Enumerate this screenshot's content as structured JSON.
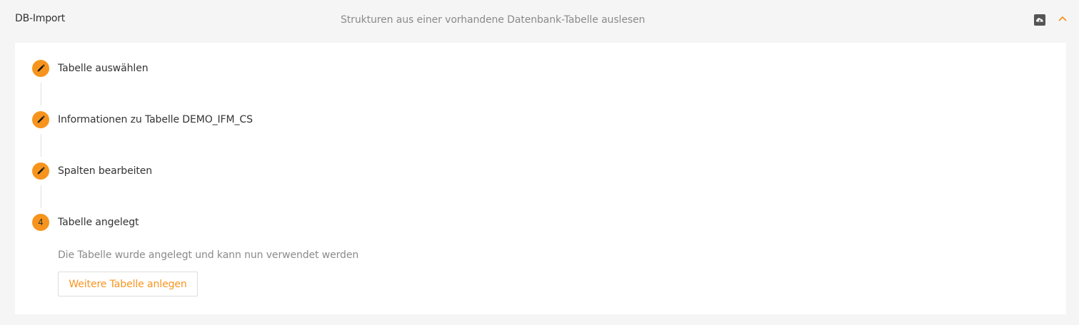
{
  "panel": {
    "title": "DB-Import",
    "description": "Strukturen aus einer vorhandene Datenbank-Tabelle auslesen",
    "actions": {
      "upload_icon": "cloud-upload-icon",
      "collapse_icon": "chevron-up-icon"
    }
  },
  "steps": [
    {
      "label": "Tabelle auswählen",
      "state": "edit",
      "icon": "pencil-icon"
    },
    {
      "label": "Informationen zu Tabelle DEMO_IFM_CS",
      "state": "edit",
      "icon": "pencil-icon"
    },
    {
      "label": "Spalten bearbeiten",
      "state": "edit",
      "icon": "pencil-icon"
    },
    {
      "label": "Tabelle angelegt",
      "state": "active",
      "number": "4"
    }
  ],
  "current_step": {
    "message": "Die Tabelle wurde angelegt und kann nun verwendet werden",
    "button_label": "Weitere Tabelle anlegen"
  },
  "colors": {
    "accent": "#f7941d",
    "header_bg": "#f5f5f5",
    "body_bg": "#ffffff",
    "muted_text": "#8a8a8a",
    "text": "#333333"
  }
}
